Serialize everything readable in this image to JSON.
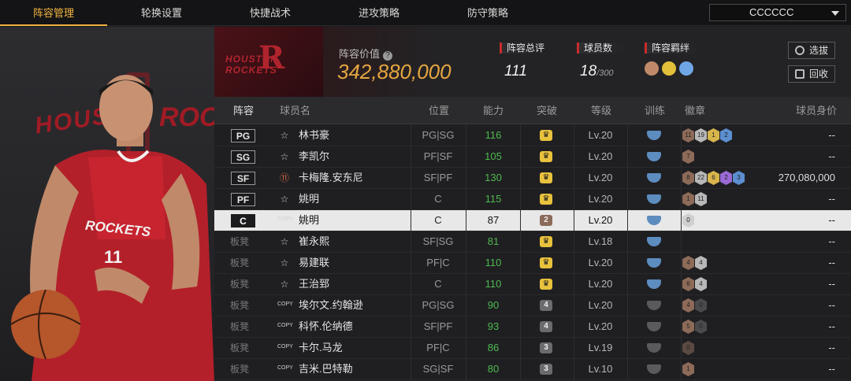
{
  "nav": {
    "tabs": [
      "阵容管理",
      "轮换设置",
      "快捷战术",
      "进攻策略",
      "防守策略"
    ],
    "active_tab": 0,
    "team_select": "CCCCCC"
  },
  "header": {
    "value_label": "阵容价值",
    "value": "342,880,000",
    "rating_label": "阵容总评",
    "rating": "111",
    "players_label": "球员数",
    "players_count": "18",
    "players_max": "/300",
    "bond_label": "阵容羁绊",
    "btn_select": "选拔",
    "btn_recycle": "回收",
    "logo_text": "HOUSTON ROCKETS"
  },
  "left_panel": {
    "bg_text_1": "HOUSTO",
    "bg_text_2": "ROCK"
  },
  "table": {
    "headers": [
      "阵容",
      "球员名",
      "位置",
      "能力",
      "突破",
      "等级",
      "训练",
      "徽章",
      "球员身价"
    ],
    "rows": [
      {
        "slot": "PG",
        "card": "star",
        "name": "林书豪",
        "pos": "PG|SG",
        "ability": "116",
        "breakthrough": "crown",
        "level": "Lv.20",
        "train": "blue",
        "badges": [
          {
            "t": "11",
            "c": "#8d6b58"
          },
          {
            "t": "19",
            "c": "#b8b8b8"
          },
          {
            "t": "1",
            "c": "#d8b44c"
          },
          {
            "t": "2",
            "c": "#5c8fd0"
          }
        ],
        "value": "--"
      },
      {
        "slot": "SG",
        "card": "star",
        "name": "李凯尔",
        "pos": "PF|SF",
        "ability": "105",
        "breakthrough": "crown",
        "level": "Lv.20",
        "train": "blue",
        "badges": [
          {
            "t": "7",
            "c": "#8d6b58"
          }
        ],
        "value": "--"
      },
      {
        "slot": "SF",
        "card": "eleven",
        "name": "卡梅隆.安东尼",
        "pos": "SF|PF",
        "ability": "130",
        "breakthrough": "crown",
        "level": "Lv.20",
        "train": "blue",
        "badges": [
          {
            "t": "8",
            "c": "#8d6b58"
          },
          {
            "t": "22",
            "c": "#b8b8b8"
          },
          {
            "t": "6",
            "c": "#d8b44c"
          },
          {
            "t": "2",
            "c": "#9a6ad6"
          },
          {
            "t": "3",
            "c": "#5c8fd0"
          }
        ],
        "value": "270,080,000"
      },
      {
        "slot": "PF",
        "card": "star",
        "name": "姚明",
        "pos": "C",
        "ability": "115",
        "breakthrough": "crown",
        "level": "Lv.20",
        "train": "blue",
        "badges": [
          {
            "t": "1",
            "c": "#8d6b58"
          },
          {
            "t": "11",
            "c": "#b8b8b8"
          }
        ],
        "value": "--"
      },
      {
        "slot": "C",
        "card": "copy",
        "name": "姚明",
        "pos": "C",
        "ability": "87",
        "breakthrough": "2",
        "level": "Lv.20",
        "train": "blue",
        "badges": [
          {
            "t": "0",
            "c": "#cfcfcf"
          }
        ],
        "value": "--",
        "selected": true
      },
      {
        "slot": "板凳",
        "card": "star",
        "name": "崔永熙",
        "pos": "SF|SG",
        "ability": "81",
        "breakthrough": "crown",
        "level": "Lv.18",
        "train": "blue",
        "badges": [],
        "value": "--"
      },
      {
        "slot": "板凳",
        "card": "star",
        "name": "易建联",
        "pos": "PF|C",
        "ability": "110",
        "breakthrough": "crown",
        "level": "Lv.20",
        "train": "blue",
        "badges": [
          {
            "t": "4",
            "c": "#8d6b58"
          },
          {
            "t": "4",
            "c": "#b8b8b8"
          }
        ],
        "value": "--"
      },
      {
        "slot": "板凳",
        "card": "star",
        "name": "王治郅",
        "pos": "C",
        "ability": "110",
        "breakthrough": "crown",
        "level": "Lv.20",
        "train": "blue",
        "badges": [
          {
            "t": "6",
            "c": "#8d6b58"
          },
          {
            "t": "4",
            "c": "#b8b8b8"
          }
        ],
        "value": "--"
      },
      {
        "slot": "板凳",
        "card": "copy",
        "name": "埃尔文.约翰逊",
        "pos": "PG|SG",
        "ability": "90",
        "breakthrough": "4",
        "level": "Lv.20",
        "train": "grey",
        "badges": [
          {
            "t": "4",
            "c": "#8d6b58"
          },
          {
            "t": "0",
            "c": "#4a4a4c"
          }
        ],
        "value": "--"
      },
      {
        "slot": "板凳",
        "card": "copy",
        "name": "科怀.伦纳德",
        "pos": "SF|PF",
        "ability": "93",
        "breakthrough": "4",
        "level": "Lv.20",
        "train": "grey",
        "badges": [
          {
            "t": "5",
            "c": "#8d6b58"
          },
          {
            "t": "0",
            "c": "#4a4a4c"
          }
        ],
        "value": "--"
      },
      {
        "slot": "板凳",
        "card": "copy",
        "name": "卡尔.马龙",
        "pos": "PF|C",
        "ability": "86",
        "breakthrough": "3",
        "level": "Lv.19",
        "train": "grey",
        "badges": [
          {
            "t": "0",
            "c": "#5a4a42"
          }
        ],
        "value": "--"
      },
      {
        "slot": "板凳",
        "card": "copy",
        "name": "吉米.巴特勒",
        "pos": "SG|SF",
        "ability": "80",
        "breakthrough": "3",
        "level": "Lv.10",
        "train": "grey",
        "badges": [
          {
            "t": "1",
            "c": "#8d6b58"
          }
        ],
        "value": "--"
      }
    ]
  },
  "colors": {
    "accent": "#f0b341",
    "value_gold": "#e5a640",
    "ability_green": "#4fb94f",
    "rockets_red": "#b0242e"
  }
}
